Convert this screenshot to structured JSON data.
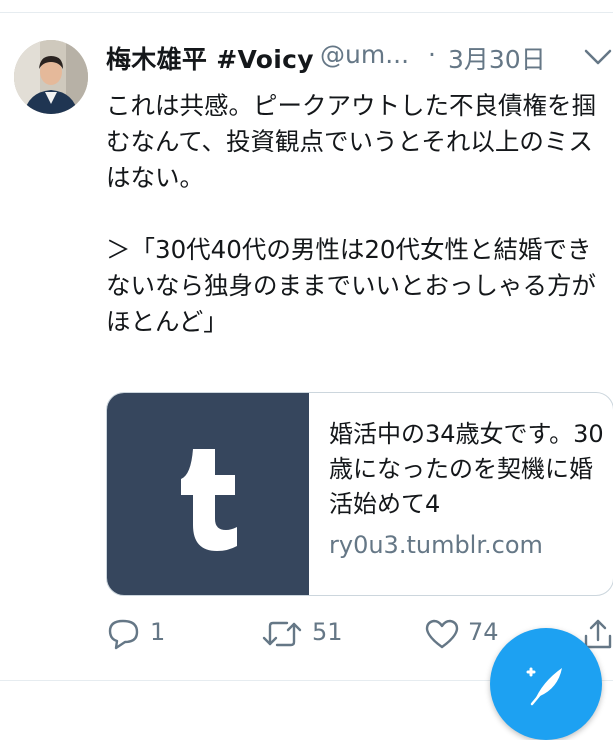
{
  "tweet": {
    "display_name": "梅木雄平 #Voicy",
    "handle": "@um...",
    "separator": "·",
    "date": "3月30日",
    "text": "これは共感。ピークアウトした不良債権を掴むなんて、投資観点でいうとそれ以上のミスはない。\n\n＞「30代40代の男性は20代女性と結婚できないなら独身のままでいいとおっしゃる方がほとんど」",
    "avatar_icon": "user-avatar",
    "menu_icon": "chevron-down-icon"
  },
  "card": {
    "thumbnail_icon": "tumblr-logo",
    "thumbnail_color": "#36465d",
    "title": "婚活中の34歳女です。30歳になったのを契機に婚活始めて4",
    "domain": "ry0u3.tumblr.com"
  },
  "actions": {
    "reply_count": "1",
    "retweet_count": "51",
    "like_count": "74"
  },
  "colors": {
    "accent": "#1da1f2",
    "secondary_text": "#657786",
    "divider": "#e6ecf0"
  }
}
